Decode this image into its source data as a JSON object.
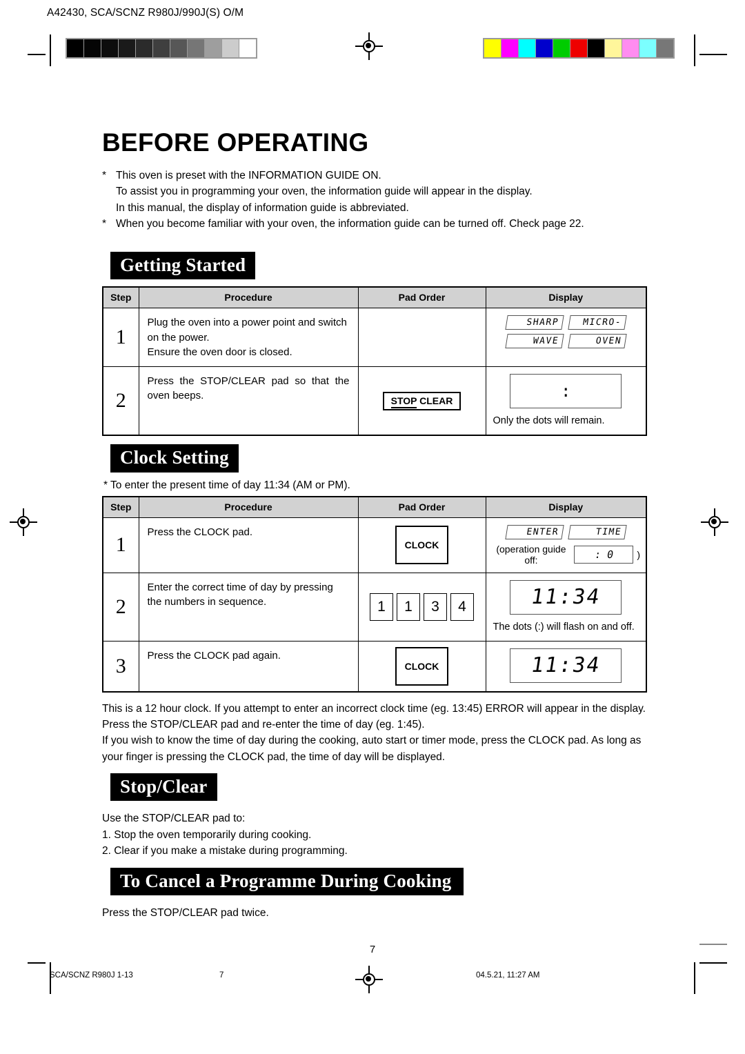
{
  "prepress": {
    "job_code": "A42430, SCA/SCNZ R980J/990J(S) O/M",
    "greyscale_swatches": [
      "#000000",
      "#050505",
      "#0d0d0d",
      "#1a1a1a",
      "#2b2b2b",
      "#3f3f3f",
      "#575757",
      "#767676",
      "#9e9e9e",
      "#cccccc",
      "#ffffff"
    ],
    "color_swatches": [
      "#ffff00",
      "#ff00ff",
      "#00ffff",
      "#0000cc",
      "#00cc00",
      "#ee0000",
      "#000000",
      "#fff69b",
      "#ff8cf0",
      "#7bffff",
      "#777777"
    ]
  },
  "page": {
    "title": "BEFORE OPERATING",
    "page_number": "7",
    "intro_bullets": [
      {
        "marker": "*",
        "lines": [
          "This oven is preset with the INFORMATION GUIDE ON.",
          "To assist you in programming your oven, the information guide will appear in the display.",
          "In this manual, the display of information guide is abbreviated."
        ]
      },
      {
        "marker": "*",
        "lines": [
          "When you become familiar with your oven, the information guide can be turned off. Check page 22."
        ]
      }
    ]
  },
  "getting_started": {
    "heading": "Getting Started",
    "columns": [
      "Step",
      "Procedure",
      "Pad Order",
      "Display"
    ],
    "rows": [
      {
        "step": "1",
        "procedure": "Plug the oven into a power point and switch on the power.\nEnsure the oven door is closed.",
        "pad": "",
        "display_lcd_row1": [
          "SHARP",
          "MICRO-"
        ],
        "display_lcd_row2": [
          "WAVE",
          "OVEN"
        ],
        "caption": ""
      },
      {
        "step": "2",
        "procedure": "Press the STOP/CLEAR pad so that the oven beeps.",
        "pad_key_top": "STOP",
        "pad_key_bottom": "CLEAR",
        "display_dots": ":",
        "caption": "Only the dots will remain."
      }
    ]
  },
  "clock_setting": {
    "heading": "Clock Setting",
    "note": "* To enter the present time of day 11:34 (AM or PM).",
    "columns": [
      "Step",
      "Procedure",
      "Pad Order",
      "Display"
    ],
    "rows": [
      {
        "step": "1",
        "procedure": "Press the CLOCK pad.",
        "pad_key": "CLOCK",
        "display_lcd_row1": [
          "ENTER",
          "TIME"
        ],
        "guide_off_prefix": "(operation guide off:",
        "guide_off_lcd": ": 0",
        "guide_off_suffix": ")"
      },
      {
        "step": "2",
        "procedure": "Enter the correct time of day by pressing the numbers in sequence.",
        "numpads": [
          "1",
          "1",
          "3",
          "4"
        ],
        "display_time": "11:34",
        "caption": "The dots (:) will flash on and off."
      },
      {
        "step": "3",
        "procedure": "Press the CLOCK pad again.",
        "pad_key": "CLOCK",
        "display_time": "11:34",
        "caption": ""
      }
    ],
    "after_paragraphs": [
      "This is a 12 hour clock. If you attempt to enter an incorrect clock time (eg. 13:45)  ERROR will appear in the display. Press the STOP/CLEAR pad and re-enter the time of day (eg. 1:45).",
      "If you wish to know the time of day during the cooking, auto start or timer mode, press the CLOCK pad. As long as your finger is pressing the CLOCK pad, the time of day will be displayed."
    ]
  },
  "stop_clear": {
    "heading": "Stop/Clear",
    "intro": "Use the STOP/CLEAR pad to:",
    "items": [
      "1. Stop the oven temporarily during cooking.",
      "2. Clear if you make a mistake during programming."
    ]
  },
  "cancel_programme": {
    "heading": "To Cancel a Programme During Cooking",
    "body": "Press the STOP/CLEAR pad twice."
  },
  "footer": {
    "left": "SCA/SCNZ R980J 1-13",
    "page": "7",
    "right": "04.5.21, 11:27 AM"
  }
}
